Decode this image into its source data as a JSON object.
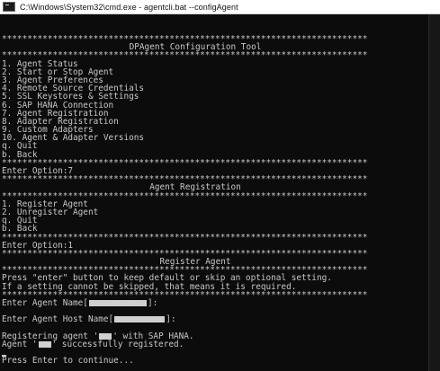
{
  "window": {
    "title": "C:\\Windows\\System32\\cmd.exe - agentcli.bat  --configAgent"
  },
  "console": {
    "sep": "************************************************************************",
    "main_menu": {
      "title": "DPAgent Configuration Tool",
      "items": [
        "1. Agent Status",
        "2. Start or Stop Agent",
        "3. Agent Preferences",
        "4. Remote Source Credentials",
        "5. SSL Keystores & Settings",
        "6. SAP HANA Connection",
        "7. Agent Registration",
        "8. Adapter Registration",
        "9. Custom Adapters",
        "10. Agent & Adapter Versions",
        "q. Quit",
        "b. Back"
      ],
      "prompt": "Enter Option:7"
    },
    "registration_menu": {
      "title": "Agent Registration",
      "items": [
        "1. Register Agent",
        "2. Unregister Agent",
        "q. Quit",
        "b. Back"
      ],
      "prompt": "Enter Option:1"
    },
    "register_agent": {
      "title": "Register Agent",
      "info_line1": "Press \"enter\" button to keep default or skip an optional setting.",
      "info_line2": "If a setting cannot be skipped, that means it is required.",
      "name_prompt_start": "Enter Agent Name[",
      "name_prompt_end": "]:",
      "host_prompt_start": "Enter Agent Host Name[",
      "host_prompt_end": "]:",
      "registering_start": "Registering agent '",
      "registering_end": "' with SAP HANA.",
      "success_start": "Agent '",
      "success_end": "' successfully registered.",
      "continue": "Press Enter to continue..."
    }
  }
}
